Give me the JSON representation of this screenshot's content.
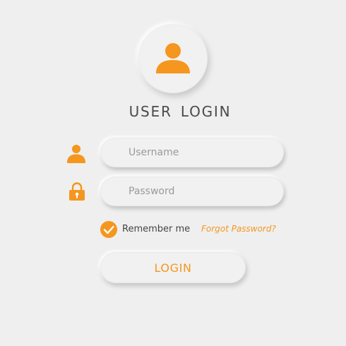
{
  "colors": {
    "accent": "#f5961e",
    "background": "#efefef",
    "text": "#4a4a4a"
  },
  "header": {
    "avatar_icon": "user-icon",
    "title": "USER LOGIN"
  },
  "form": {
    "username": {
      "icon": "user-icon",
      "placeholder": "Username",
      "value": ""
    },
    "password": {
      "icon": "padlock-icon",
      "placeholder": "Password",
      "value": ""
    },
    "remember": {
      "label": "Remember me",
      "checked": true,
      "icon": "checkmark-icon"
    },
    "forgot_label": "Forgot Password?",
    "login_label": "LOGIN"
  }
}
